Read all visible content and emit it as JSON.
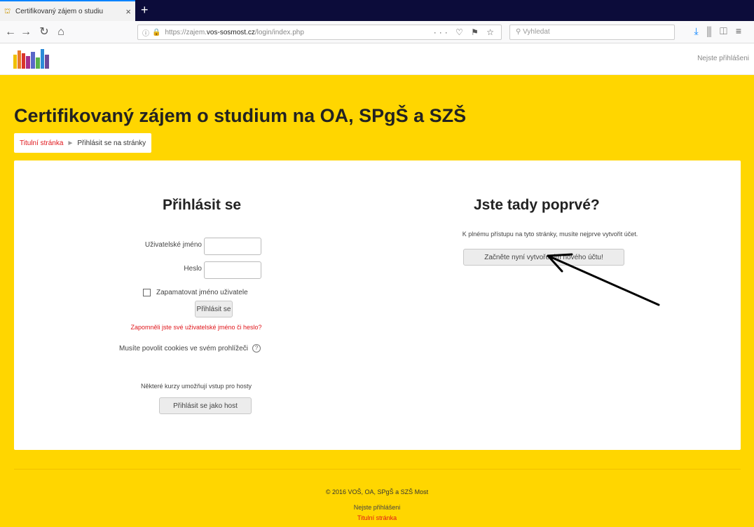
{
  "browser": {
    "tab_title": "Certifikovaný zájem o studiu",
    "url_prefix": "https://zajem.",
    "url_host": "vos-sosmost.cz",
    "url_path": "/login/index.php",
    "search_placeholder": "Vyhledat",
    "url_actions": "··· ♡ ⚑ ☆"
  },
  "header": {
    "login_status": "Nejste přihlášeni"
  },
  "page": {
    "title": "Certifikovaný zájem o studium na OA, SPgŠ a SZŠ",
    "breadcrumb_home": "Titulní stránka",
    "breadcrumb_sep": "►",
    "breadcrumb_current": "Přihlásit se na stránky"
  },
  "login": {
    "heading": "Přihlásit se",
    "username_label": "Uživatelské jméno",
    "password_label": "Heslo",
    "remember_label": "Zapamatovat jméno uživatele",
    "submit_label": "Přihlásit se",
    "forgot_link": "Zapomněli jste své uživatelské jméno či heslo?",
    "cookies_text": "Musíte povolit cookies ve svém prohlížeči",
    "guest_text": "Některé kurzy umožňují vstup pro hosty",
    "guest_button": "Přihlásit se jako host"
  },
  "signup": {
    "heading": "Jste tady poprvé?",
    "text": "K plnému přístupu na tyto stránky, musíte nejprve vytvořit účet.",
    "button": "Začněte nyní vytvořením nového účtu!"
  },
  "footer": {
    "copyright": "© 2016 VOŠ, OA, SPgŠ a SZŠ Most",
    "login_status": "Nejste přihlášeni",
    "home_link": "Titulní stránka"
  },
  "colors": {
    "page_background": "#ffd600",
    "link_red": "#e0161b",
    "tabbar": "#0c0c3a"
  }
}
